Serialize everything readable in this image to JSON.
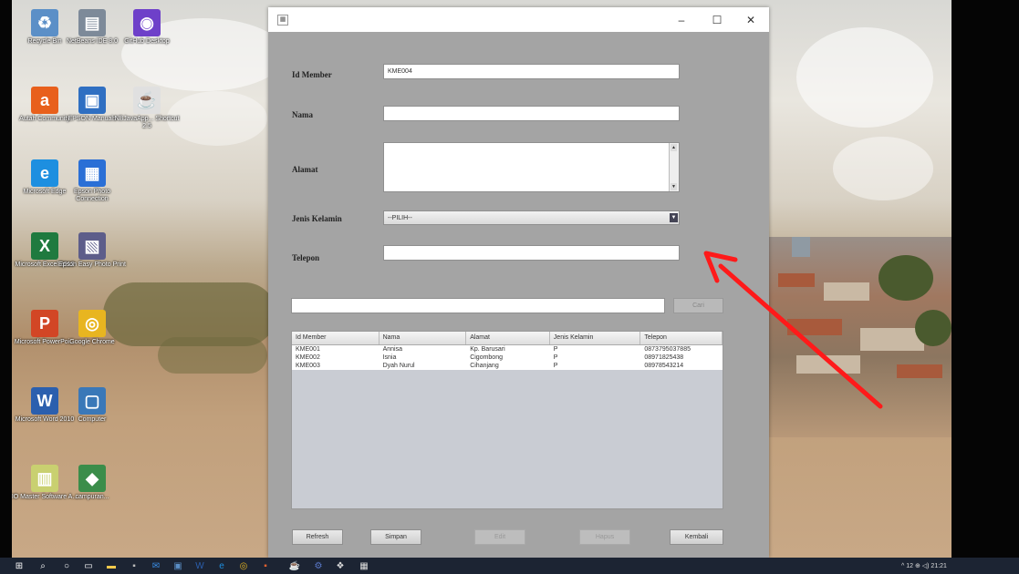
{
  "desktop": {
    "icons": [
      {
        "label": "Recycle Bin",
        "color": "#5b8fc7",
        "glyph": "♻"
      },
      {
        "label": "NetBeans IDE 8.0",
        "color": "#7d8a99",
        "glyph": "▤"
      },
      {
        "label": "GitHub Desktop",
        "color": "#6e40c9",
        "glyph": "◉"
      },
      {
        "label": "Autah Community",
        "color": "#e8601c",
        "glyph": "a"
      },
      {
        "label": "EPSON Manuals",
        "color": "#2f6fc2",
        "glyph": "▣"
      },
      {
        "label": "NBJavaApp... Shortcut 2.5",
        "color": "#e0e0e0",
        "glyph": "☕"
      },
      {
        "label": "Microsoft Edge",
        "color": "#1d8fe0",
        "glyph": "e"
      },
      {
        "label": "Epson Photo Connection",
        "color": "#2a6fd6",
        "glyph": "▦"
      },
      {
        "label": "Microsoft Excel 2010",
        "color": "#1f7a3f",
        "glyph": "X"
      },
      {
        "label": "Epson Easy Photo Print",
        "color": "#5d5d8a",
        "glyph": "▧"
      },
      {
        "label": "Microsoft PowerPoi...",
        "color": "#d24625",
        "glyph": "P"
      },
      {
        "label": "Google Chrome",
        "color": "#e8b520",
        "glyph": "◎"
      },
      {
        "label": "Microsoft Word 2010",
        "color": "#2b5fae",
        "glyph": "W"
      },
      {
        "label": "Computer",
        "color": "#3a78b8",
        "glyph": "▢"
      },
      {
        "label": "IO Master Software A...",
        "color": "#c9d070",
        "glyph": "▥"
      },
      {
        "label": "campuran...",
        "color": "#3b8d4a",
        "glyph": "◆"
      }
    ]
  },
  "window": {
    "controls": {
      "minimize": "–",
      "maximize": "☐",
      "close": "✕"
    },
    "form": {
      "id_member_label": "Id Member",
      "id_member_value": "KME004",
      "nama_label": "Nama",
      "nama_value": "",
      "alamat_label": "Alamat",
      "alamat_value": "",
      "jenis_kelamin_label": "Jenis Kelamin",
      "jenis_kelamin_value": "--PILIH--",
      "telepon_label": "Telepon",
      "telepon_value": ""
    },
    "search": {
      "value": "",
      "button": "Cari"
    },
    "table": {
      "columns": [
        "Id Member",
        "Nama",
        "Alamat",
        "Jenis Kelamin",
        "Telepon"
      ],
      "rows": [
        [
          "KME001",
          "Annisa",
          "Kp. Barusari",
          "P",
          "0873795037885"
        ],
        [
          "KME002",
          "Isnia",
          "Cigombong",
          "P",
          "08971825438"
        ],
        [
          "KME003",
          "Dyah Nurul",
          "Cihanjang",
          "P",
          "08978543214"
        ]
      ]
    },
    "buttons": {
      "refresh": "Refresh",
      "simpan": "Simpan",
      "edit": "Edit",
      "hapus": "Hapus",
      "kembali": "Kembali"
    }
  },
  "annotation": {
    "color": "#ff1a1a"
  },
  "taskbar": {
    "tray_text": "^ 12 ⊕ ◁) 21:21"
  }
}
